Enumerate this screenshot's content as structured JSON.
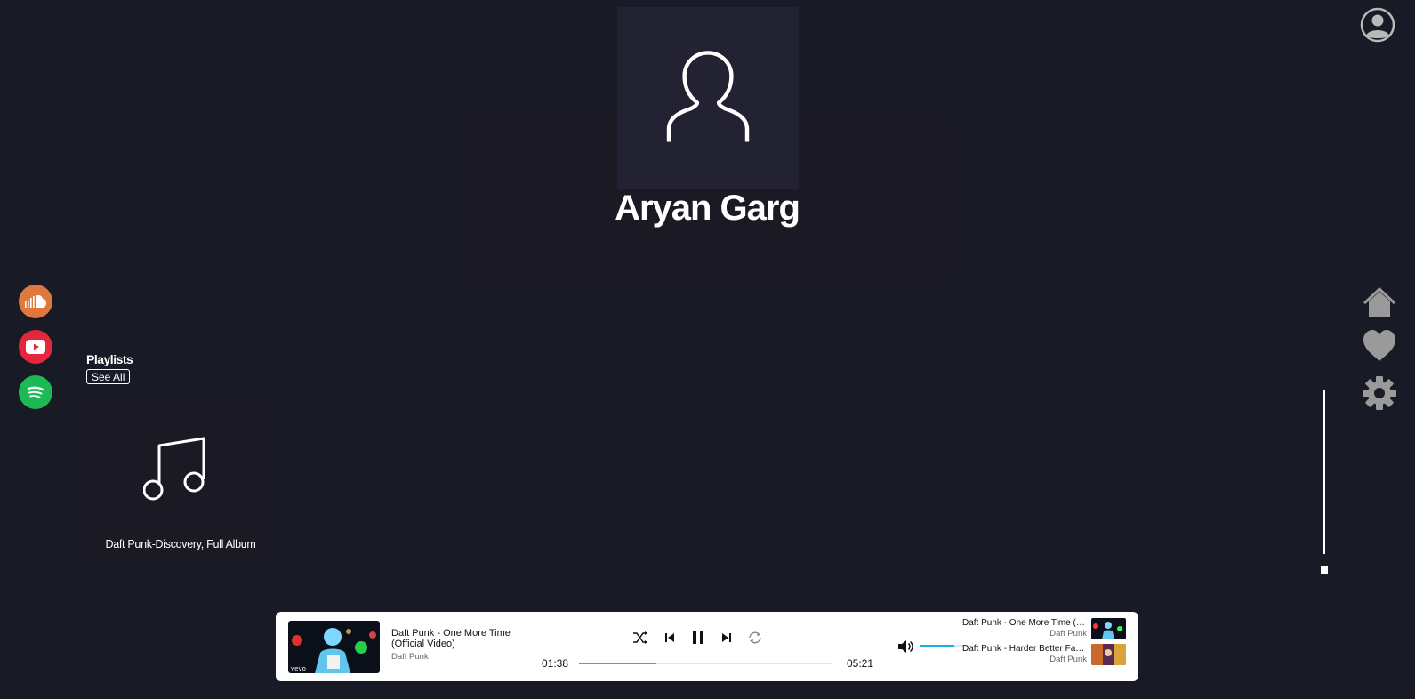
{
  "profile": {
    "name": "Aryan Garg",
    "avatar_icon": "user-outline-icon"
  },
  "header": {
    "account_icon": "account-circle-icon"
  },
  "sources": [
    {
      "name": "soundcloud",
      "icon": "soundcloud-icon",
      "color": "#e0783d"
    },
    {
      "name": "youtube",
      "icon": "youtube-icon",
      "color": "#e3273c"
    },
    {
      "name": "spotify",
      "icon": "spotify-icon",
      "color": "#1db954"
    }
  ],
  "nav": {
    "icons": [
      "home-icon",
      "heart-icon",
      "gear-icon"
    ],
    "color": "#9a9a9a"
  },
  "playlists": {
    "heading": "Playlists",
    "see_all_label": "See All",
    "items": [
      {
        "title": "Daft Punk-Discovery, Full Album",
        "icon": "music-note-icon"
      }
    ]
  },
  "side_volume": {
    "level": 0.95
  },
  "player": {
    "now_playing": {
      "title": "Daft Punk - One More Time (Official Video)",
      "artist": "Daft Punk",
      "thumbnail_label": "vevo"
    },
    "controls": [
      "shuffle-icon",
      "previous-icon",
      "pause-icon",
      "next-icon",
      "repeat-icon"
    ],
    "time_current": "01:38",
    "time_total": "05:21",
    "progress": 0.305,
    "volume": 0.7,
    "accent_color": "#14b6ea",
    "queue": [
      {
        "title": "Daft Punk - One More Time (Official Video)",
        "artist": "Daft Punk"
      },
      {
        "title": "Daft Punk - Harder Better Faster Stronger",
        "artist": "Daft Punk"
      }
    ]
  }
}
